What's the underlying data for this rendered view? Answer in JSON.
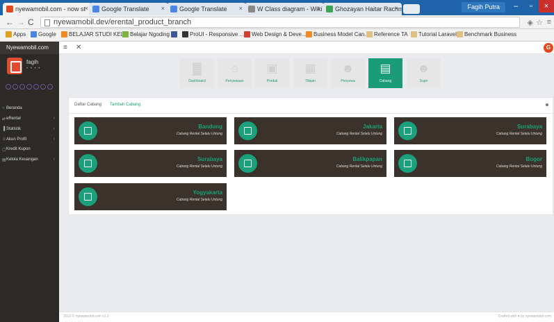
{
  "browser": {
    "tabs": [
      {
        "label": "nyewamobil.com - now st",
        "fav": "#e2481e",
        "active": true
      },
      {
        "label": "Google Translate",
        "fav": "#4a86e8",
        "active": false
      },
      {
        "label": "Google Translate",
        "fav": "#4a86e8",
        "active": false
      },
      {
        "label": "W Class diagram - Wikipedia",
        "fav": "#888888",
        "active": false
      },
      {
        "label": "Ghozayan Haitar Rachmad",
        "fav": "#3aa655",
        "active": false
      }
    ],
    "user": "Fagih Putra",
    "url": "nyewamobil.dev/erental_product_branch",
    "bookmarks": [
      {
        "label": "Apps",
        "color": "#e0a020"
      },
      {
        "label": "Google",
        "color": "#4a86e8"
      },
      {
        "label": "BELAJAR STUDI KEL...",
        "color": "#f08a24"
      },
      {
        "label": "Belajar Ngoding",
        "color": "#7cb342"
      },
      {
        "label": "",
        "color": "#3b5998"
      },
      {
        "label": "ProUI - Responsive ...",
        "color": "#333333"
      },
      {
        "label": "Web Design & Deve...",
        "color": "#d23f31"
      },
      {
        "label": "Business Model Can...",
        "color": "#f08a24"
      },
      {
        "label": "Reference TA",
        "color": "#e0c080"
      },
      {
        "label": "Tutorial Laravel",
        "color": "#e0c080"
      },
      {
        "label": "Benchmark Business",
        "color": "#e0c080"
      }
    ]
  },
  "app": {
    "brand": "Nyewamobil.com",
    "user_name": "fagih",
    "user_sub": "• • • •",
    "menu": [
      {
        "label": "Beranda",
        "icon": "○",
        "chev": ""
      },
      {
        "label": "eRental",
        "icon": "⇄",
        "chev": "‹"
      },
      {
        "label": "Statistik",
        "icon": "▐",
        "chev": "‹"
      },
      {
        "label": "Akun Profil",
        "icon": "☺",
        "chev": "‹"
      },
      {
        "label": "Kredit Kupon",
        "icon": "▢",
        "chev": ""
      },
      {
        "label": "Kelola Keuangan",
        "icon": "▤",
        "chev": "‹"
      }
    ],
    "nav": [
      {
        "label": "Dashboard",
        "glyph": "▓",
        "active": false
      },
      {
        "label": "Penyewaan",
        "glyph": "⌂",
        "active": false
      },
      {
        "label": "Produk",
        "glyph": "▣",
        "active": false
      },
      {
        "label": "Titipan",
        "glyph": "▦",
        "active": false
      },
      {
        "label": "Penyewa",
        "glyph": "☻",
        "active": false
      },
      {
        "label": "Cabang",
        "glyph": "▤",
        "active": true
      },
      {
        "label": "Supir",
        "glyph": "☻",
        "active": false
      }
    ],
    "panel_tabs": [
      "Daftar Cabang",
      "Tambah Cabang"
    ],
    "branches": [
      {
        "name": "Bandung",
        "sub": "Cabang Rental Selalu Untung"
      },
      {
        "name": "Jakarta",
        "sub": "Cabang Rental Selalu Untung"
      },
      {
        "name": "Surabaya",
        "sub": "Cabang Rental Selalu Untung"
      },
      {
        "name": "Surabaya",
        "sub": "Cabang Rental Selalu Untung"
      },
      {
        "name": "Balikpapan",
        "sub": "Cabang Rental Selalu Untung"
      },
      {
        "name": "Bogor",
        "sub": "Cabang Rental Selalu Untung"
      },
      {
        "name": "Yogyakarta",
        "sub": "Cabang Rental Selalu Untung"
      }
    ],
    "footer_left": "2016 © nyewamobil.com v1.0",
    "footer_right": "Crafted with ♥ by nyewamobil.com"
  }
}
